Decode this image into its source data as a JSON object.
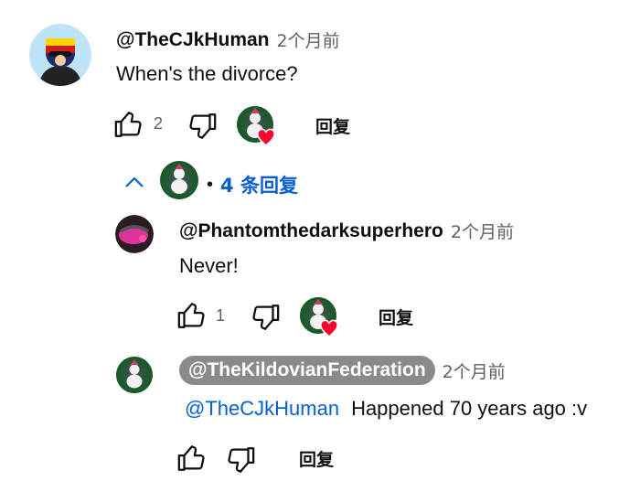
{
  "comment": {
    "author": "@TheCJkHuman",
    "time": "2个月前",
    "text": "When's the divorce?",
    "likes": "2",
    "reply_label": "回复"
  },
  "replies_toggle": {
    "separator": "•",
    "label": "4 条回复"
  },
  "reply1": {
    "author": "@Phantomthedarksuperhero",
    "time": "2个月前",
    "text": "Never!",
    "likes": "1",
    "reply_label": "回复"
  },
  "reply2": {
    "author": "@TheKildovianFederation",
    "time": "2个月前",
    "mention": "@TheCJkHuman",
    "text": "Happened 70 years ago :v",
    "reply_label": "回复"
  },
  "colors": {
    "link_blue": "#065fd4",
    "heart_red": "#ff0033",
    "muted": "#606060"
  }
}
